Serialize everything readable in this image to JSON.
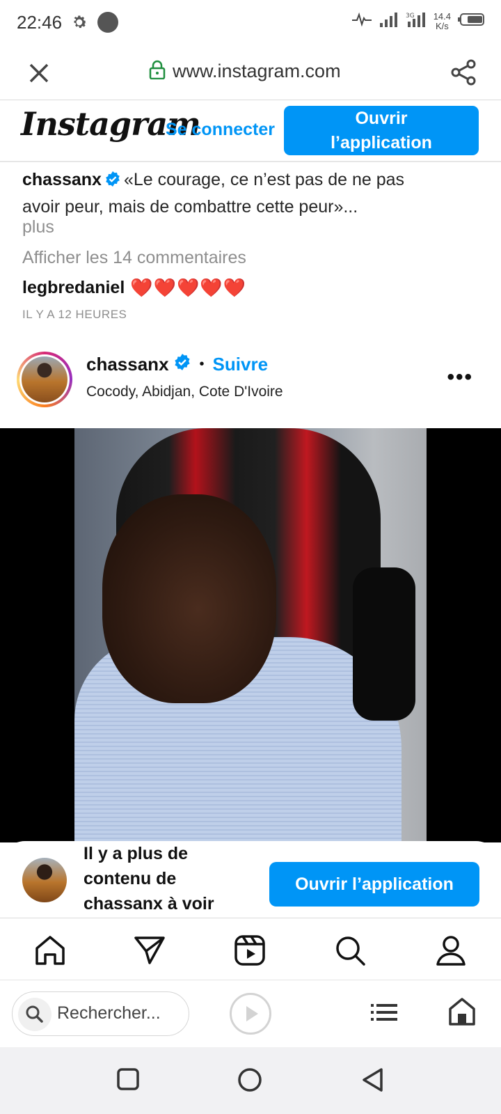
{
  "status_bar": {
    "time": "22:46",
    "speed_value": "14.4",
    "speed_unit": "K/s",
    "icons": [
      "gear-icon",
      "notification-dot",
      "activity-icon",
      "signal-icon",
      "signal-3g-icon",
      "battery-icon"
    ]
  },
  "url_bar": {
    "url": "www.instagram.com",
    "icons": [
      "close-icon",
      "lock-icon",
      "share-icon"
    ]
  },
  "ig_header": {
    "logo": "Instagram",
    "login_label": "Se connecter",
    "open_app_line1": "Ouvrir",
    "open_app_line2": "l’application"
  },
  "caption": {
    "username": "chassanx",
    "text_line1": "«Le courage, ce n’est pas de ne pas",
    "text_line2": "avoir peur, mais de combattre cette peur»...",
    "more": "plus"
  },
  "comments": {
    "view_all": "Afficher les 14 commentaires",
    "items": [
      {
        "username": "legbredaniel",
        "text": "❤️❤️❤️❤️❤️"
      }
    ],
    "timestamp": "IL Y A 12 HEURES"
  },
  "post": {
    "username": "chassanx",
    "separator": "•",
    "follow_label": "Suivre",
    "location": "Cocody, Abidjan, Cote D'Ivoire",
    "more_label": "•••"
  },
  "more_banner": {
    "line1": "Il y a plus de",
    "line2": "contenu de",
    "line3": "chassanx à voir",
    "button": "Ouvrir l’application"
  },
  "ig_nav": {
    "items": [
      "home-icon",
      "direct-icon",
      "reels-icon",
      "search-icon",
      "profile-icon"
    ]
  },
  "browser_bar": {
    "search_placeholder": "Rechercher..."
  },
  "colors": {
    "accent": "#0095f6",
    "text": "#262626",
    "muted": "#8e8e8e",
    "heart": "#e0245e"
  }
}
